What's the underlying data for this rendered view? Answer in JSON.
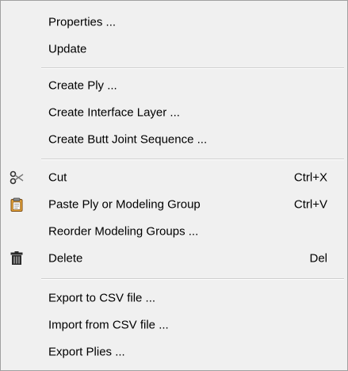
{
  "menu": {
    "properties": {
      "label": "Properties ..."
    },
    "update": {
      "label": "Update"
    },
    "create_ply": {
      "label": "Create Ply ..."
    },
    "create_interface_layer": {
      "label": "Create Interface Layer ..."
    },
    "create_butt_joint_sequence": {
      "label": "Create Butt Joint Sequence ..."
    },
    "cut": {
      "label": "Cut",
      "shortcut": "Ctrl+X",
      "icon": "scissors-icon"
    },
    "paste": {
      "label": "Paste Ply or Modeling Group",
      "shortcut": "Ctrl+V",
      "icon": "clipboard-icon"
    },
    "reorder": {
      "label": "Reorder Modeling Groups ..."
    },
    "delete": {
      "label": "Delete",
      "shortcut": "Del",
      "icon": "trash-icon"
    },
    "export_csv": {
      "label": "Export to CSV file ..."
    },
    "import_csv": {
      "label": "Import from CSV file ..."
    },
    "export_plies": {
      "label": "Export Plies ..."
    }
  }
}
